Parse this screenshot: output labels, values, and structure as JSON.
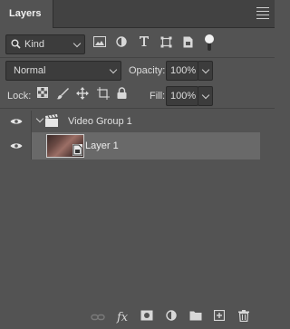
{
  "panel": {
    "tab_label": "Layers",
    "menu_icon": "panel-menu-icon"
  },
  "filter": {
    "kind_label": "Kind",
    "icons": [
      "pixel-filter-icon",
      "adjustment-filter-icon",
      "type-filter-icon",
      "shape-filter-icon",
      "smart-object-filter-icon"
    ],
    "toggle_on": true
  },
  "blend": {
    "mode": "Normal",
    "opacity_label": "Opacity:",
    "opacity_value": "100%"
  },
  "lock": {
    "label": "Lock:",
    "icons": [
      "lock-transparent-icon",
      "lock-image-icon",
      "lock-position-icon",
      "lock-artboard-icon",
      "lock-all-icon"
    ],
    "fill_label": "Fill:",
    "fill_value": "100%"
  },
  "layers": [
    {
      "name": "Video Group 1",
      "type": "video-group",
      "visible": true,
      "expanded": true
    },
    {
      "name": "Layer 1",
      "type": "smart-object",
      "visible": true,
      "selected": true
    }
  ],
  "footer": {
    "icons": [
      "link-layers-icon",
      "layer-style-icon",
      "add-mask-icon",
      "adjustment-layer-icon",
      "new-group-icon",
      "new-layer-icon",
      "delete-layer-icon"
    ],
    "fx_label": "fx"
  },
  "colors": {
    "panel_bg": "#535353",
    "selected_row": "#696969",
    "field_bg": "#3c3c3c"
  }
}
